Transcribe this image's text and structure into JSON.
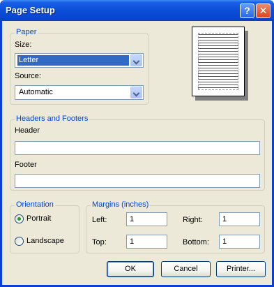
{
  "window": {
    "title": "Page Setup",
    "help_glyph": "?",
    "close_glyph": "✕"
  },
  "paper": {
    "legend": "Paper",
    "size_label": "Size:",
    "size_value": "Letter",
    "source_label": "Source:",
    "source_value": "Automatic"
  },
  "headers_footers": {
    "legend": "Headers and Footers",
    "header_label": "Header",
    "header_value": "",
    "footer_label": "Footer",
    "footer_value": ""
  },
  "orientation": {
    "legend": "Orientation",
    "portrait_label": "Portrait",
    "landscape_label": "Landscape",
    "selected": "portrait"
  },
  "margins": {
    "legend": "Margins (inches)",
    "left_label": "Left:",
    "left_value": "1",
    "right_label": "Right:",
    "right_value": "1",
    "top_label": "Top:",
    "top_value": "1",
    "bottom_label": "Bottom:",
    "bottom_value": "1"
  },
  "buttons": {
    "ok": "OK",
    "cancel": "Cancel",
    "printer": "Printer..."
  }
}
